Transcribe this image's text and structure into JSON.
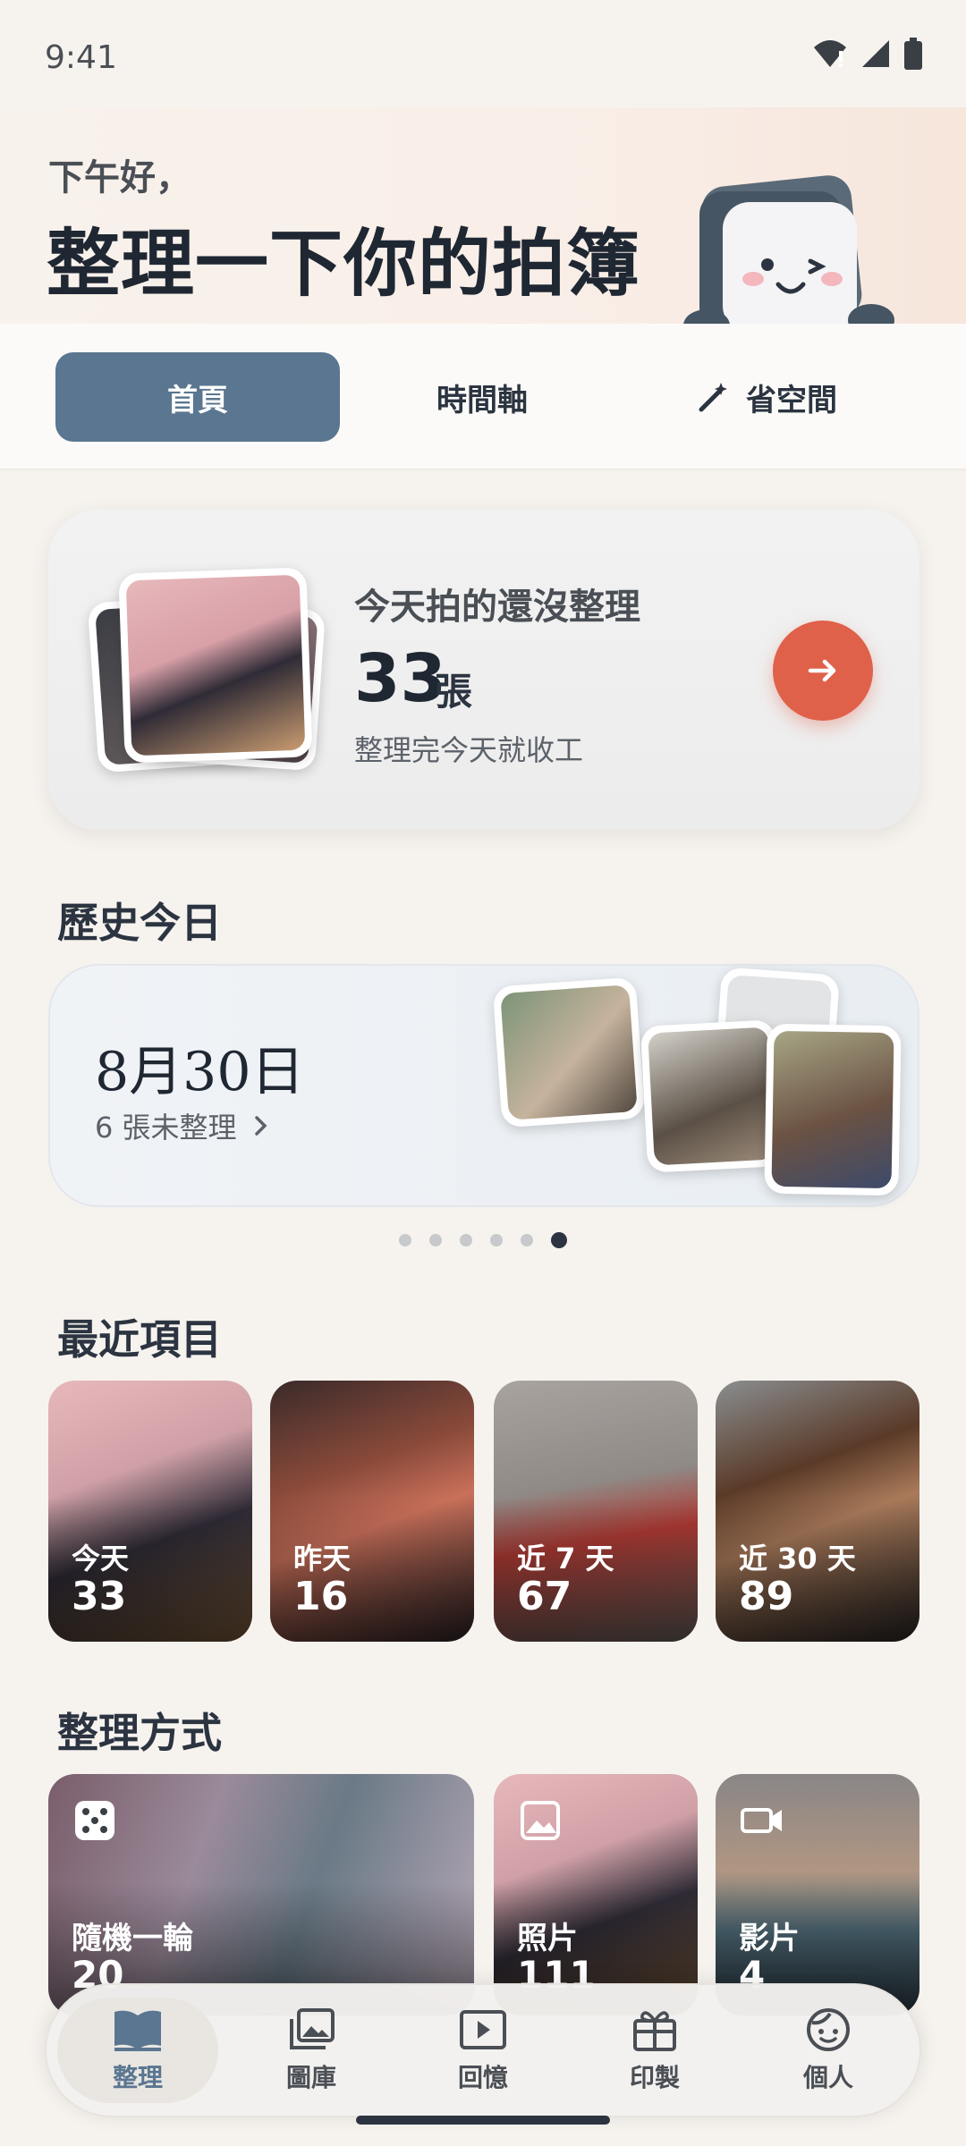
{
  "status": {
    "time": "9:41"
  },
  "header": {
    "greeting": "下午好，",
    "headline": "整理一下你的拍簿"
  },
  "tabs": [
    {
      "label": "首頁",
      "active": true
    },
    {
      "label": "時間軸",
      "active": false
    },
    {
      "label": "省空間",
      "active": false,
      "icon": "magic-wand-icon"
    }
  ],
  "today_card": {
    "title": "今天拍的還沒整理",
    "count": "33",
    "unit": "張",
    "subtitle": "整理完今天就收工"
  },
  "history": {
    "section_title": "歷史今日",
    "date": "8月30日",
    "subtitle": "6 張未整理",
    "pages": 6,
    "active_page": 6
  },
  "recent": {
    "section_title": "最近項目",
    "items": [
      {
        "label": "今天",
        "count": "33"
      },
      {
        "label": "昨天",
        "count": "16"
      },
      {
        "label": "近 7 天",
        "count": "67"
      },
      {
        "label": "近 30 天",
        "count": "89"
      }
    ]
  },
  "organize": {
    "section_title": "整理方式",
    "items": [
      {
        "label": "隨機一輪",
        "count": "20",
        "icon": "dice-icon"
      },
      {
        "label": "照片",
        "count": "111",
        "icon": "image-icon"
      },
      {
        "label": "影片",
        "count": "4",
        "icon": "video-icon"
      }
    ]
  },
  "bottom_nav": [
    {
      "label": "整理",
      "icon": "book-icon",
      "active": true
    },
    {
      "label": "圖庫",
      "icon": "gallery-icon",
      "active": false
    },
    {
      "label": "回憶",
      "icon": "play-icon",
      "active": false
    },
    {
      "label": "印製",
      "icon": "gift-box-icon",
      "active": false
    },
    {
      "label": "個人",
      "icon": "face-icon",
      "active": false
    }
  ],
  "colors": {
    "accent": "#5a7690",
    "action": "#e0614a",
    "background": "#f6f3ef"
  }
}
